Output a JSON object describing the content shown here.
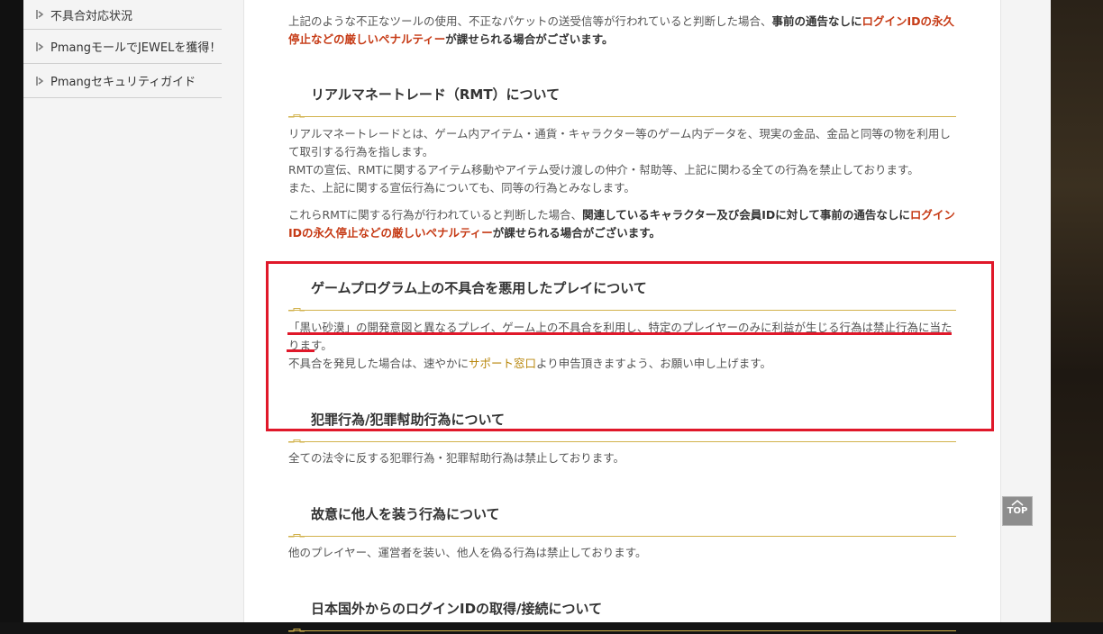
{
  "sidebar": {
    "items": [
      {
        "label": "不具合対応状況"
      },
      {
        "label": "PmangモールでJEWELを獲得！"
      },
      {
        "label": "Pmangセキュリティガイド"
      }
    ]
  },
  "content": {
    "intro": {
      "text1": "上記のような不正なツールの使用、不正なパケットの送受信等が行われていると判断した場合、",
      "bold1": "事前の通告なしに",
      "red1": "ログインIDの永久停止などの厳しいペナルティー",
      "text2": "が課せられる場合がございます。"
    },
    "rmt": {
      "heading": "リアルマネートレード（RMT）について",
      "p1_l1": "リアルマネートレードとは、ゲーム内アイテム・通貨・キャラクター等のゲーム内データを、現実の金品、金品と同等の物を利用して取引する行為を指します。",
      "p1_l2": "RMTの宣伝、RMTに関するアイテム移動やアイテム受け渡しの仲介・幇助等、上記に関わる全ての行為を禁止しております。",
      "p1_l3": "また、上記に関する宣伝行為についても、同等の行為とみなします。",
      "p2_text1": "これらRMTに関する行為が行われていると判断した場合、",
      "p2_bold": "関連しているキャラクター及び会員IDに対して事前の通告なしに",
      "p2_red": "ログインIDの永久停止などの厳しいペナルティー",
      "p2_text2": "が課せられる場合がございます。"
    },
    "bug": {
      "heading": "ゲームプログラム上の不具合を悪用したプレイについて",
      "p1": "「黒い砂漠」の開発意図と異なるプレイ、ゲーム上の不具合を利用し、特定のプレイヤーのみに利益が生じる行為は禁止行為に当たります。",
      "p2_before": "不具合を発見した場合は、速やかに",
      "p2_link": "サポート窓口",
      "p2_after": "より申告頂きますよう、お願い申し上げます。"
    },
    "crime": {
      "heading": "犯罪行為/犯罪幇助行為について",
      "p1": "全ての法令に反する犯罪行為・犯罪幇助行為は禁止しております。"
    },
    "impersonation": {
      "heading": "故意に他人を装う行為について",
      "p1": "他のプレイヤー、運営者を装い、他人を偽る行為は禁止しております。"
    },
    "foreign": {
      "heading": "日本国外からのログインIDの取得/接続について"
    }
  },
  "top_button": {
    "label": "TOP"
  },
  "colors": {
    "accent_red": "#c63b16",
    "link_gold": "#b8860b",
    "heading_line": "#d2b24c",
    "annotation_red": "#e0182a"
  }
}
